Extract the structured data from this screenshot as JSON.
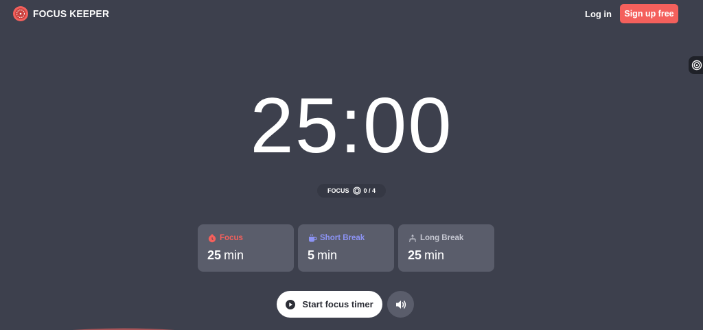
{
  "header": {
    "logo_text": "FOCUS KEEPER",
    "login_label": "Log in",
    "signup_label": "Sign up free"
  },
  "timer": {
    "display": "25:00"
  },
  "session": {
    "mode_label": "FOCUS",
    "progress": "0 / 4"
  },
  "modes": [
    {
      "label": "Focus",
      "minutes": "25",
      "unit": "min",
      "color": "#f4605c",
      "icon": "tomato-icon"
    },
    {
      "label": "Short Break",
      "minutes": "5",
      "unit": "min",
      "color": "#8c93f4",
      "icon": "coffee-cup-icon"
    },
    {
      "label": "Long Break",
      "minutes": "25",
      "unit": "min",
      "color": "#c6c8d2",
      "icon": "lounge-chair-icon"
    }
  ],
  "controls": {
    "start_label": "Start focus timer"
  },
  "colors": {
    "background": "#3d404d",
    "accent": "#f4605c",
    "card": "#5a5d6b"
  }
}
